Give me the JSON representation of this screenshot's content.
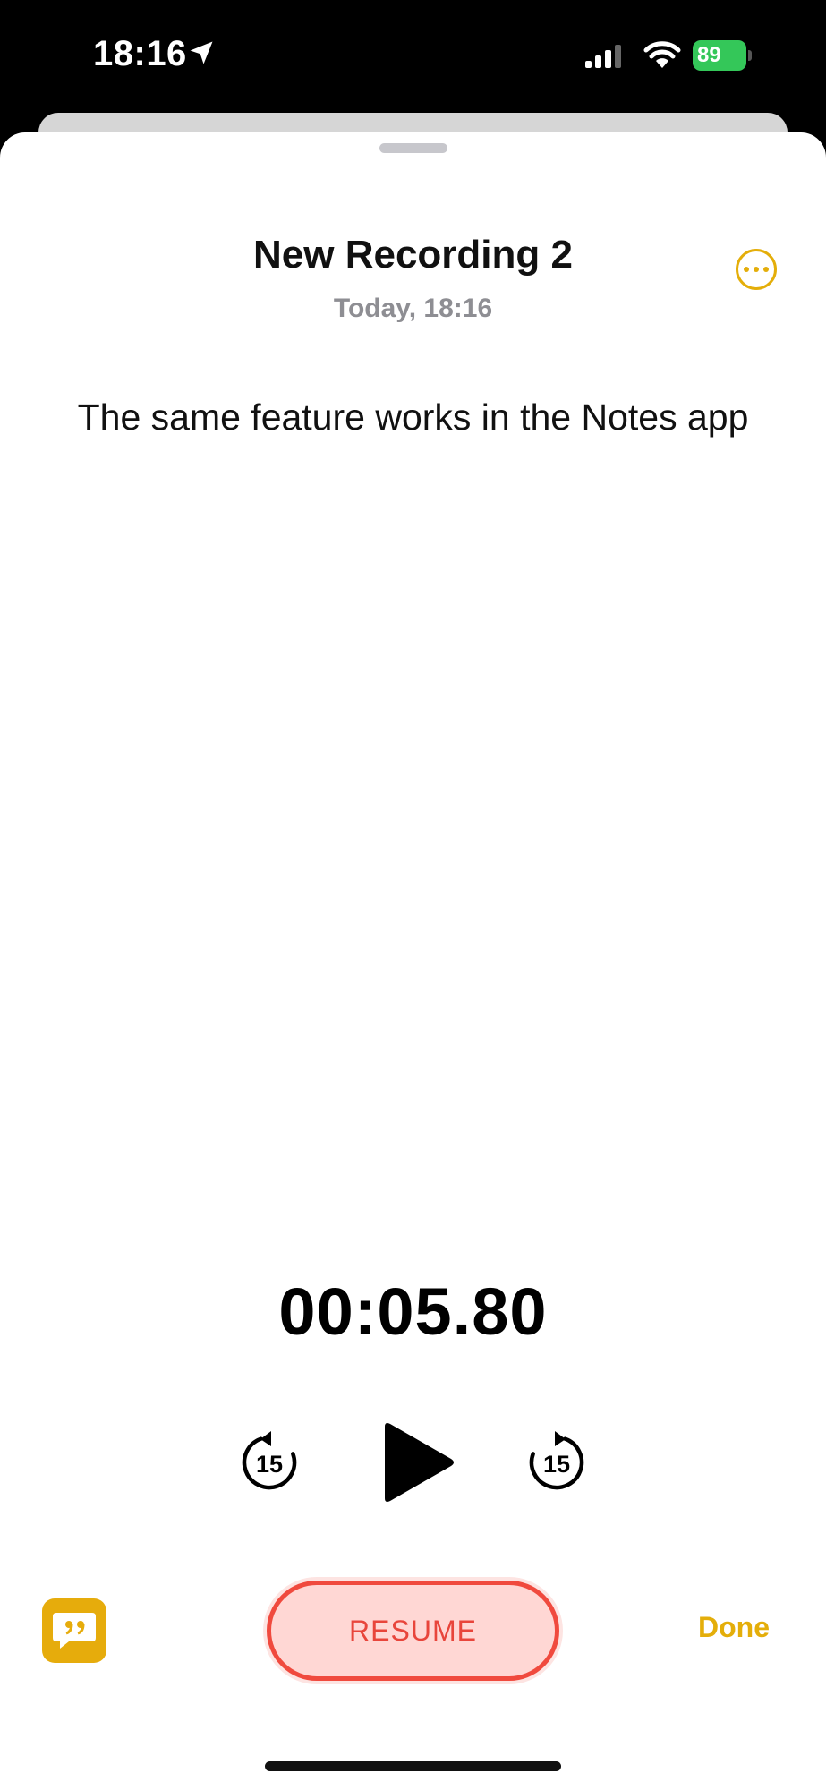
{
  "status_bar": {
    "time": "18:16",
    "battery_level": "89",
    "icons": [
      "location-arrow-icon",
      "cellular-signal-icon",
      "wifi-icon",
      "battery-charging-icon"
    ]
  },
  "recording": {
    "title": "New Recording 2",
    "date": "Today, 18:16",
    "transcript": "The same feature works in the Notes app",
    "elapsed": "00:05.80"
  },
  "controls": {
    "skip_back_seconds": "15",
    "skip_forward_seconds": "15",
    "resume_label": "RESUME",
    "done_label": "Done"
  },
  "colors": {
    "accent": "#e4ae0a",
    "resume_border": "#f04a3e",
    "resume_fill": "#ffd7d4",
    "battery": "#34c759"
  }
}
